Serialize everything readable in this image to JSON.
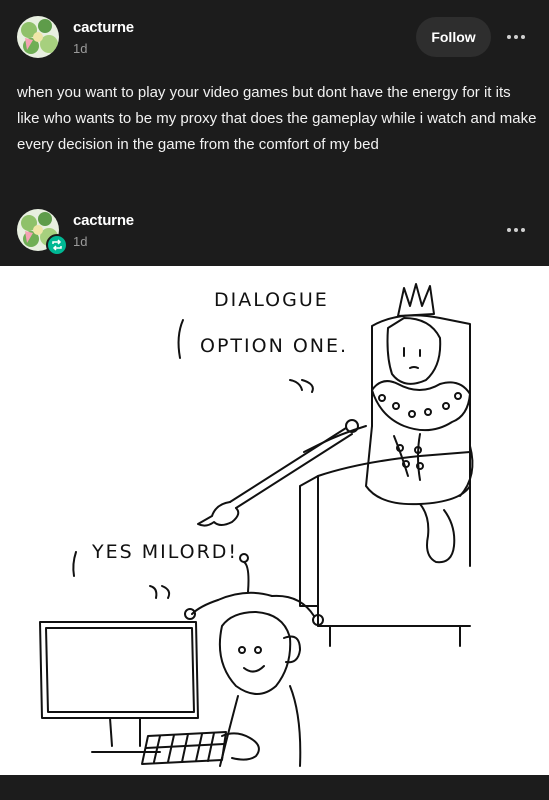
{
  "original_post": {
    "username": "cacturne",
    "timestamp": "1d",
    "follow_label": "Follow",
    "text": "when you want to play your video games but dont have the energy for it its like who wants to be my proxy that does the gameplay while i watch and make every decision in the game from the comfort of my bed"
  },
  "reblog": {
    "username": "cacturne",
    "timestamp": "1d",
    "reblog_icon": "reblog-icon",
    "comic": {
      "king_speech_line1": "DIALOGUE",
      "king_speech_line2": "OPTION ONE.",
      "jester_speech": "YES MILORD!"
    }
  },
  "colors": {
    "background": "#1c1c1c",
    "text": "#ffffff",
    "secondary_text": "#9a9a9a",
    "follow_button_bg": "#2e2e2e",
    "reblog_badge": "#00b894"
  }
}
